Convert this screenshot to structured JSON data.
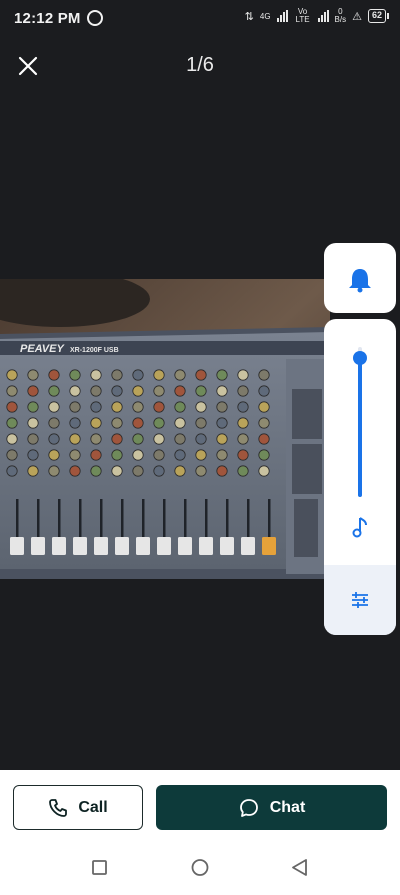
{
  "status_bar": {
    "time": "12:12 PM",
    "network": "4G",
    "volte": "Vo LTE",
    "data_rate_value": "0",
    "data_rate_unit": "B/s",
    "battery": "62"
  },
  "viewer": {
    "counter": "1/6",
    "photo_brand_text": "PEAVEY",
    "photo_model_text": "XR-1200F USB"
  },
  "volume_panel": {
    "level_fraction": 0.93
  },
  "actions": {
    "call_label": "Call",
    "chat_label": "Chat"
  },
  "colors": {
    "accent_blue": "#1a73e8",
    "chat_green": "#0d3a3a",
    "background": "#1b1c1f"
  },
  "icons": {
    "close": "close-icon",
    "bell": "bell-icon",
    "music": "music-note-icon",
    "settings": "equalizer-icon",
    "phone": "phone-icon",
    "chat": "chat-bubble-icon",
    "nav_recent": "square-icon",
    "nav_home": "circle-icon",
    "nav_back": "triangle-back-icon"
  }
}
